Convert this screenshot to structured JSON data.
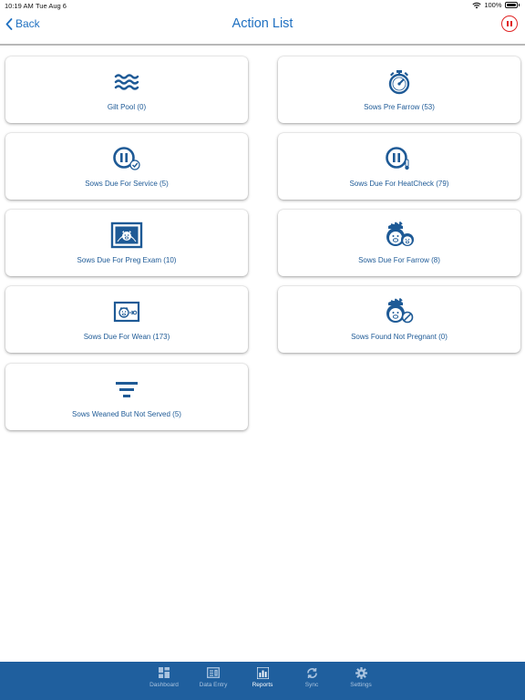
{
  "status_bar": {
    "time": "10:19 AM",
    "date": "Tue Aug 6",
    "battery": "100%"
  },
  "nav": {
    "back_label": "Back",
    "title": "Action List"
  },
  "actions": [
    {
      "label": "Gilt Pool (0)",
      "icon": "waves-icon"
    },
    {
      "label": "Sows Pre Farrow (53)",
      "icon": "stopwatch-icon"
    },
    {
      "label": "Sows Due For Service (5)",
      "icon": "pause-check-icon"
    },
    {
      "label": "Sows Due For HeatCheck (79)",
      "icon": "pause-thermometer-icon"
    },
    {
      "label": "Sows Due For Preg Exam (10)",
      "icon": "ultrasound-pig-icon"
    },
    {
      "label": "Sows Due For Farrow (8)",
      "icon": "pig-family-icon"
    },
    {
      "label": "Sows Due For Wean (173)",
      "icon": "wean-pig-icon"
    },
    {
      "label": "Sows Found Not Pregnant (0)",
      "icon": "pig-not-pregnant-icon"
    },
    {
      "label": "Sows Weaned But Not Served (5)",
      "icon": "filter-icon"
    }
  ],
  "tabs": [
    {
      "label": "Dashboard",
      "icon": "dashboard-icon",
      "active": false
    },
    {
      "label": "Data Entry",
      "icon": "data-entry-icon",
      "active": false
    },
    {
      "label": "Reports",
      "icon": "reports-icon",
      "active": true
    },
    {
      "label": "Sync",
      "icon": "sync-icon",
      "active": false
    },
    {
      "label": "Settings",
      "icon": "gear-icon",
      "active": false
    }
  ],
  "colors": {
    "accent": "#1f70c1",
    "icon_blue": "#1e5a96",
    "tab_bar": "#1f5f9e",
    "pause_red": "#e02424"
  }
}
